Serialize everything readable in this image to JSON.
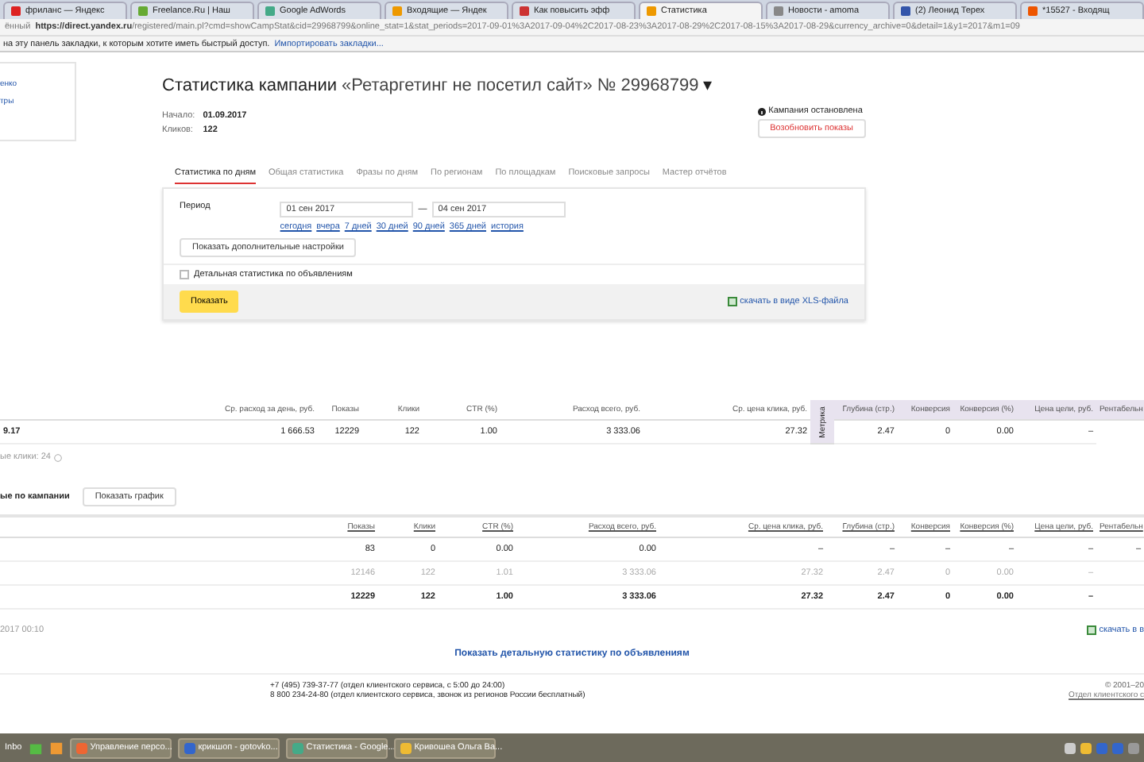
{
  "browser": {
    "tabs": [
      {
        "label": "фриланс — Яндекс",
        "selected": false
      },
      {
        "label": "Freelance.Ru | Наш",
        "selected": false
      },
      {
        "label": "Google AdWords",
        "selected": false
      },
      {
        "label": "Входящие — Яндек",
        "selected": false
      },
      {
        "label": "Как повысить эфф",
        "selected": false
      },
      {
        "label": "Статистика",
        "selected": true
      },
      {
        "label": "Новости - amoma",
        "selected": false
      },
      {
        "label": "(2) Леонид Терех",
        "selected": false
      },
      {
        "label": "*15527 - Входящ",
        "selected": false
      }
    ],
    "secure_label": "ённый",
    "url_host": "https://direct.yandex.ru",
    "url_path": "/registered/main.pl?cmd=showCampStat&cid=29968799&online_stat=1&stat_periods=2017-09-01%3A2017-09-04%2C2017-08-23%3A2017-08-29%2C2017-08-15%3A2017-08-29&currency_archive=0&detail=1&y1=2017&m1=09",
    "bookmarks_hint": "на эту панель закладки, к которым хотите иметь быстрый доступ.",
    "bookmarks_link": "Импортировать закладки..."
  },
  "sidebar": {
    "links": [
      "енко",
      "тры"
    ]
  },
  "header": {
    "title": "Статистика кампании",
    "campaign": "«Ретаргетинг не посетил сайт» № 29968799",
    "caret": "▾",
    "meta": [
      {
        "label": "Начало:",
        "value": "01.09.2017"
      },
      {
        "label": "Кликов:",
        "value": "122"
      }
    ],
    "status": "Кампания остановлена",
    "resume_button": "Возобновить показы"
  },
  "tabs": [
    {
      "label": "Статистика по дням",
      "selected": true
    },
    {
      "label": "Общая статистика",
      "selected": false
    },
    {
      "label": "Фразы по дням",
      "selected": false
    },
    {
      "label": "По регионам",
      "selected": false
    },
    {
      "label": "По площадкам",
      "selected": false
    },
    {
      "label": "Поисковые запросы",
      "selected": false
    },
    {
      "label": "Мастер отчётов",
      "selected": false
    }
  ],
  "filter": {
    "period_label": "Период",
    "date_from": "01 сен 2017",
    "dash": "—",
    "date_to": "04 сен 2017",
    "presets": [
      "сегодня",
      "вчера",
      "7 дней",
      "30 дней",
      "90 дней",
      "365 дней",
      "история"
    ],
    "more_button": "Показать дополнительные настройки",
    "detail_checkbox": {
      "label": "Детальная статистика по объявлениям",
      "checked": false
    },
    "show_button": "Показать",
    "download_link": "скачать в виде XLS-файла"
  },
  "summary": {
    "columns": [
      "Ср. расход за день, руб.",
      "Показы",
      "Клики",
      "CTR (%)",
      "Расход всего, руб.",
      "Ср. цена клика, руб.",
      "Метрика",
      "Глубина (стр.)",
      "Конверсия",
      "Конверсия (%)",
      "Цена цели, руб.",
      "Рентабельн"
    ],
    "row": [
      "9.17",
      "1 666.53",
      "12229",
      "122",
      "1.00",
      "3 333.06",
      "27.32",
      "2.47",
      "0",
      "0.00",
      "–"
    ],
    "note": "ые клики: 24"
  },
  "campaign_section": {
    "title": "ые по кампании",
    "chart_button": "Показать график",
    "columns": [
      "Показы",
      "Клики",
      "CTR (%)",
      "Расход всего, руб.",
      "Ср. цена клика, руб.",
      "Глубина (стр.)",
      "Конверсия",
      "Конверсия (%)",
      "Цена цели, руб.",
      "Рентабельн"
    ],
    "rows": [
      {
        "kind": "normal",
        "cells": [
          "83",
          "0",
          "0.00",
          "0.00",
          "–",
          "–",
          "–",
          "–",
          "–",
          "–"
        ]
      },
      {
        "kind": "muted",
        "cells": [
          "12146",
          "122",
          "1.01",
          "3 333.06",
          "27.32",
          "2.47",
          "0",
          "0.00",
          "–"
        ]
      },
      {
        "kind": "total",
        "cells": [
          "12229",
          "122",
          "1.00",
          "3 333.06",
          "27.32",
          "2.47",
          "0",
          "0.00",
          "–"
        ]
      }
    ],
    "updated": "2017 00:10",
    "download_link": "скачать в в"
  },
  "detail_link": "Показать детальную статистику по объявлениям",
  "footer": {
    "lines": [
      "+7 (495) 739-37-77 (отдел клиентского сервиса, с 5:00 до 24:00)",
      "8 800 234-24-80 (отдел клиентского сервиса, звонок из регионов России бесплатный)"
    ],
    "copyright": "© 2001–20",
    "service_link": "Отдел клиентского с"
  },
  "taskbar": {
    "start": "Inbo",
    "items": [
      "Управление персо...",
      "крикшоп - gotovko...",
      "Статистика - Google...",
      "Кривошеа Ольга Ва..."
    ]
  }
}
